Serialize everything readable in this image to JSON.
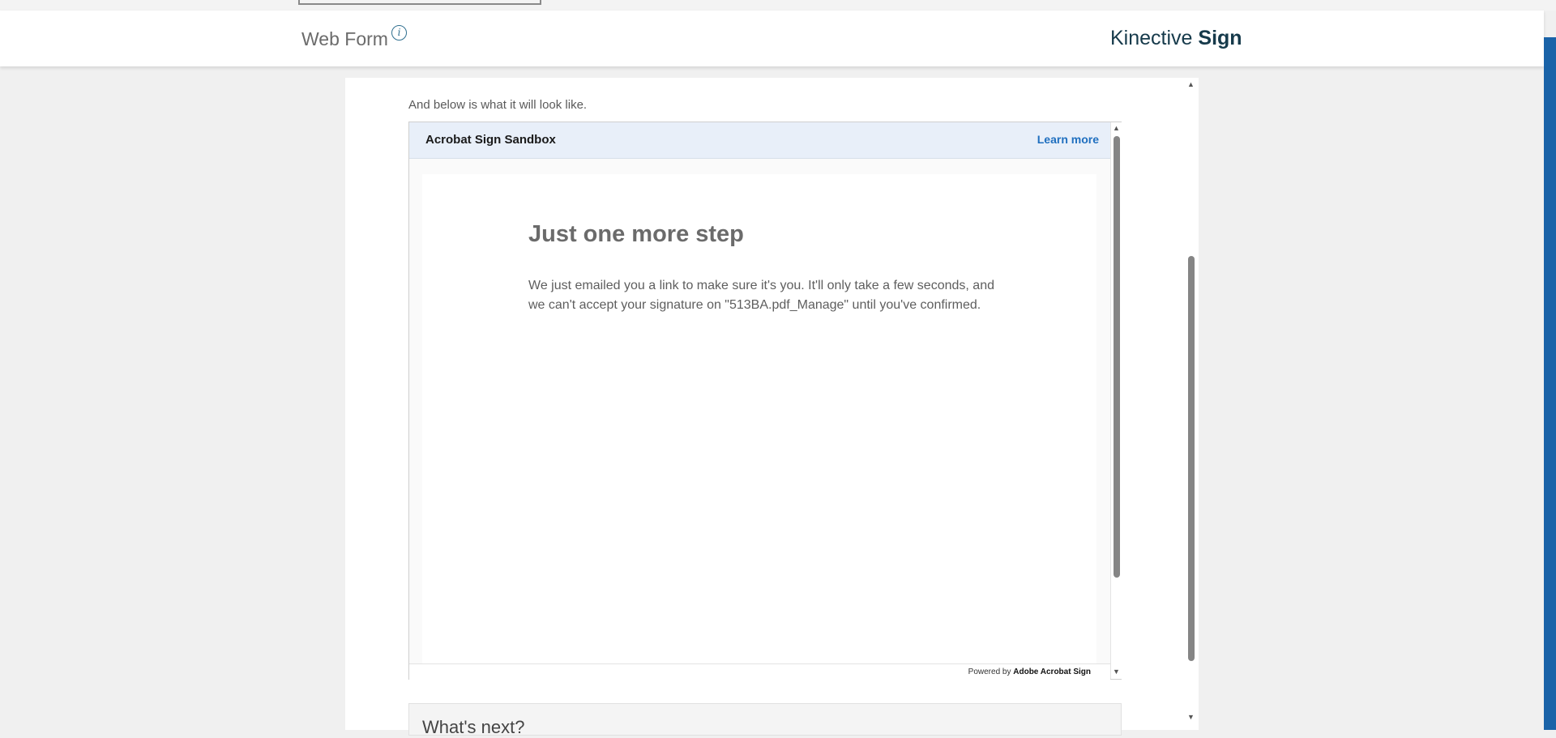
{
  "header": {
    "title": "Web Form",
    "info_icon": "i",
    "brand_light": "Kinective",
    "brand_bold": "Sign"
  },
  "main": {
    "intro": "And below is what it will look like."
  },
  "preview": {
    "frame_title": "Acrobat Sign Sandbox",
    "learn_more": "Learn more",
    "heading": "Just one more step",
    "body": "We just emailed you a link to make sure it's you. It'll only take a few seconds, and we can't accept your signature on \"513BA.pdf_Manage\" until you've confirmed.",
    "powered_prefix": "Powered by",
    "powered_brand": "Adobe Acrobat Sign"
  },
  "next": {
    "title": "What's next?"
  },
  "icons": {
    "scroll_up": "▲",
    "scroll_down": "▼"
  },
  "colors": {
    "brand": "#163a4b",
    "link": "#1f6fbf",
    "accent": "#1a63a8",
    "frame_header_bg": "#e8eff9"
  }
}
